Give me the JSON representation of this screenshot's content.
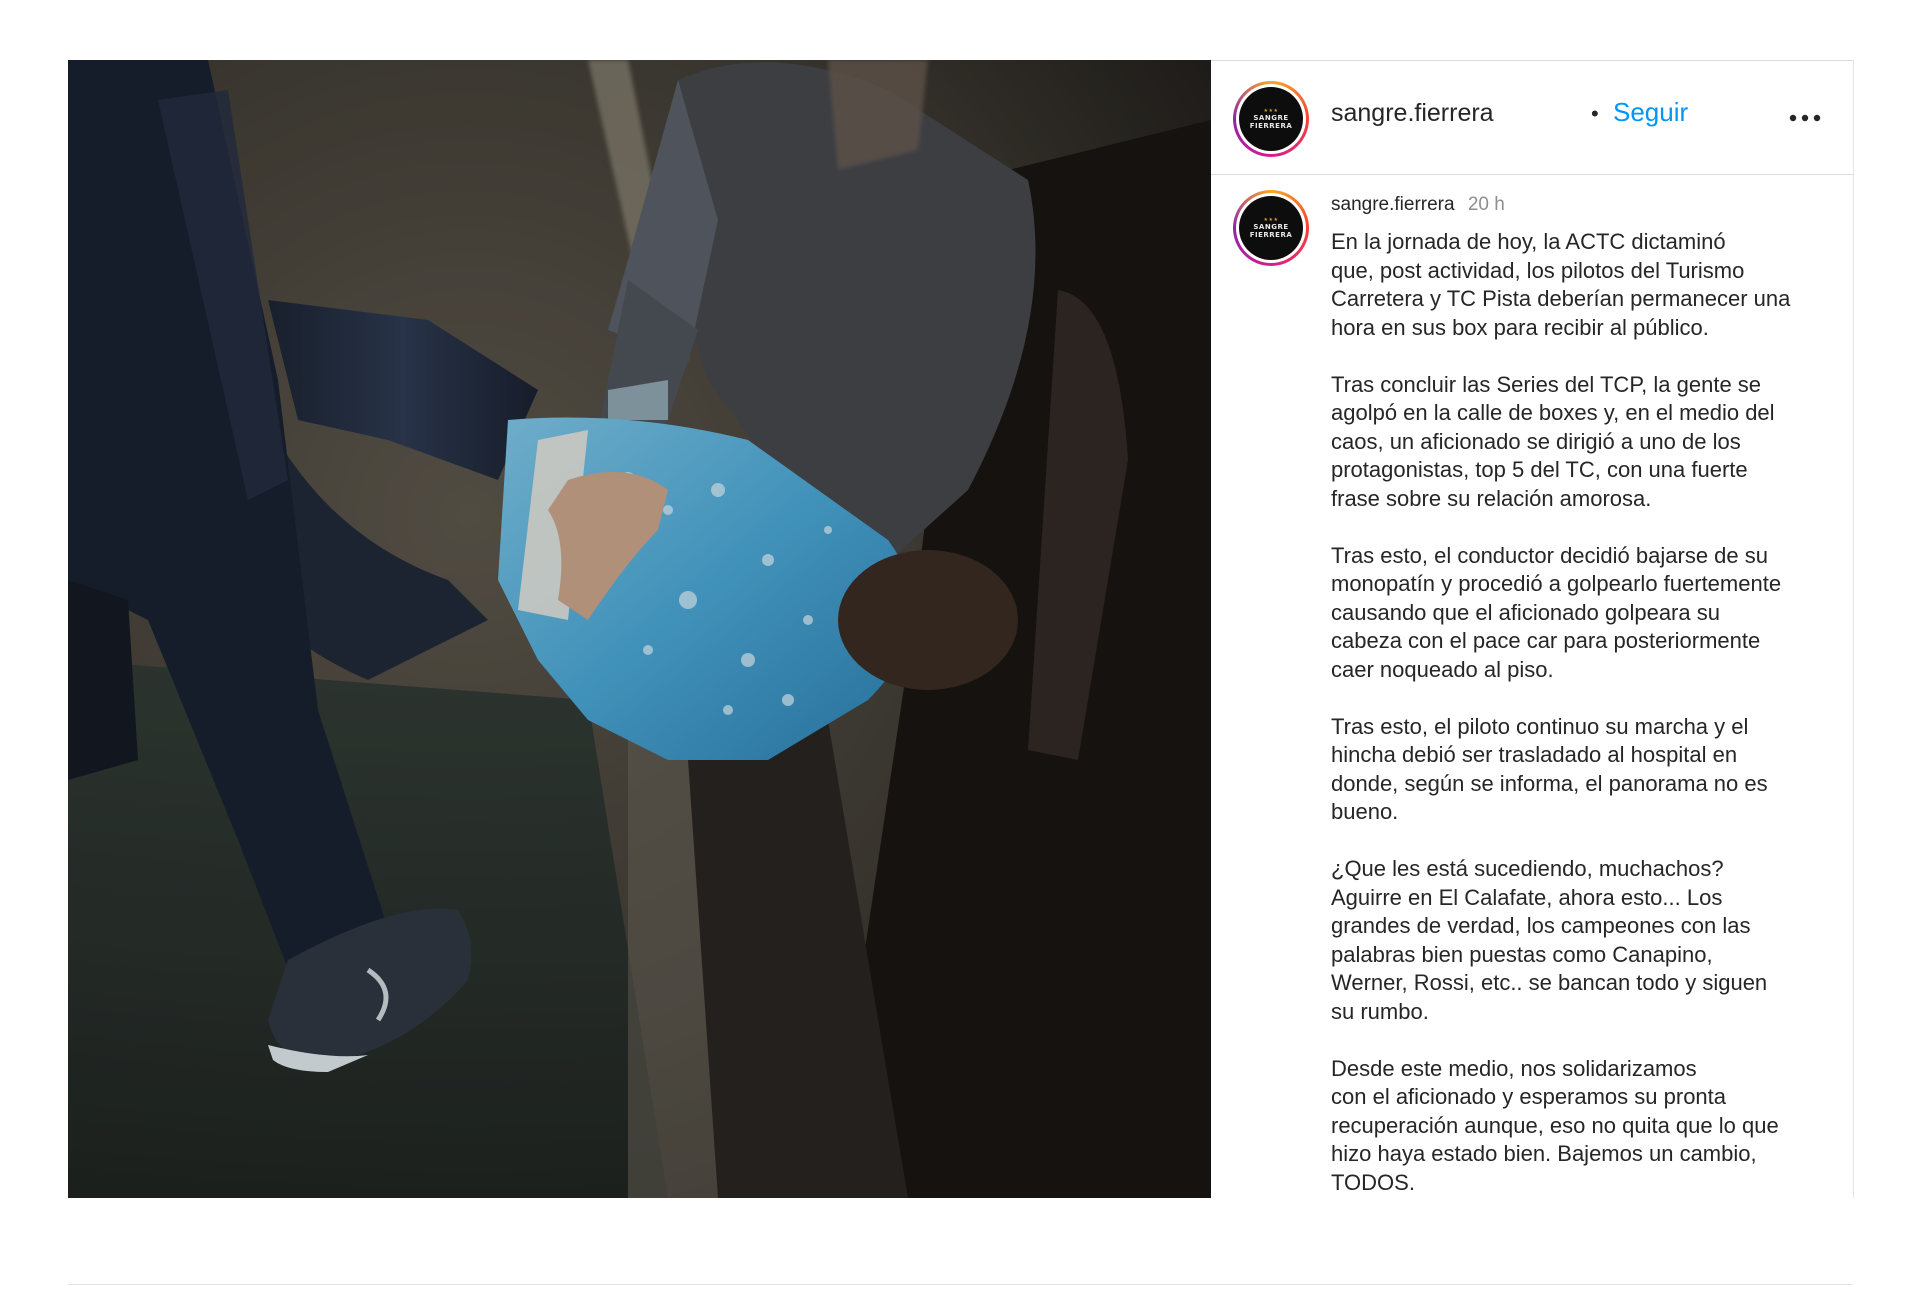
{
  "post": {
    "username": "sangre.fierrera",
    "follow_label": "Seguir",
    "separator": "•",
    "avatar_text_line1": "SANGRE",
    "avatar_text_line2": "FIERRERA",
    "caption": {
      "username": "sangre.fierrera",
      "time": "20 h",
      "paragraphs": [
        "En la jornada de hoy, la ACTC dictaminó\nque, post actividad, los pilotos del Turismo\nCarretera y TC Pista deberían permanecer una\nhora en sus box para recibir al público.",
        "Tras concluir las Series del TCP, la gente se\nagolpó en la calle de boxes y, en el medio del\ncaos, un aficionado se dirigió a uno de los\nprotagonistas, top 5 del TC, con una fuerte\nfrase sobre su relación amorosa.",
        "Tras esto, el conductor decidió bajarse de su\nmonopatín y procedió a golpearlo fuertemente\ncausando que el aficionado golpeara su\ncabeza con el pace car para posteriormente\ncaer noqueado al piso.",
        "Tras esto, el piloto continuo su marcha y el\nhincha debió ser trasladado al hospital en\ndonde, según se informa, el panorama no es\nbueno.",
        "¿Que les está sucediendo, muchachos?\nAguirre en El Calafate, ahora esto... Los\ngrandes de verdad, los campeones con las\npalabras bien puestas como Canapino,\nWerner, Rossi, etc.. se bancan todo y siguen\nsu rumbo.",
        "Desde este medio, nos solidarizamos\ncon el aficionado y esperamos su pronta\nrecuperación aunque, eso no quita que lo que\nhizo haya estado bien. Bajemos un cambio,\nTODOS."
      ]
    }
  },
  "icons": {
    "more": "more-options-icon"
  },
  "colors": {
    "link_blue": "#0095f6",
    "text": "#262626",
    "muted": "#8e8e8e"
  }
}
